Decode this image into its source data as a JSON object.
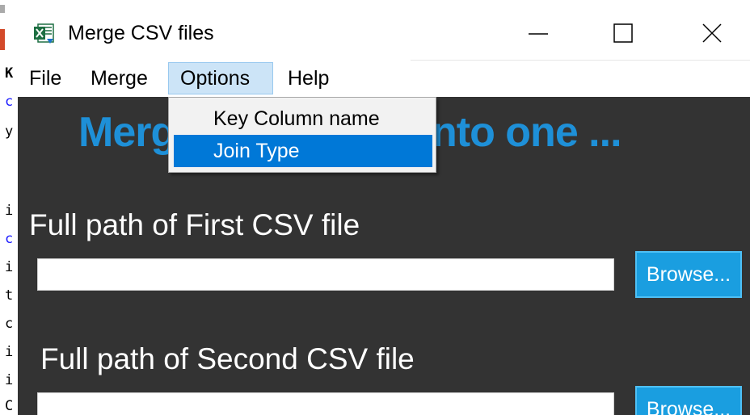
{
  "background": {
    "strip_chars": [
      "K",
      "c",
      "y",
      "i",
      "c",
      "i",
      "t",
      "c",
      "i",
      "i",
      "C"
    ]
  },
  "window": {
    "title": "Merge CSV files",
    "app_icon": "excel-icon",
    "controls": {
      "minimize_icon": "minimize-icon",
      "maximize_icon": "maximize-icon",
      "close_icon": "close-icon"
    }
  },
  "menu": {
    "items": [
      "File",
      "Merge",
      "Options",
      "Help"
    ],
    "active": "Options",
    "options_dropdown": {
      "items": [
        "Key Column name",
        "Join Type"
      ],
      "highlighted": "Join Type"
    }
  },
  "main": {
    "heading_left": "Merg",
    "heading_right": "nto one ...",
    "first_label": "Full path of First CSV file",
    "first_value": "",
    "second_label": "Full path of Second CSV file",
    "second_value": "",
    "browse_label": "Browse..."
  },
  "colors": {
    "heading": "#1e90d8",
    "content_bg": "#333333",
    "browse_bg": "#1a9ee0",
    "menu_highlight": "#0078d7"
  }
}
